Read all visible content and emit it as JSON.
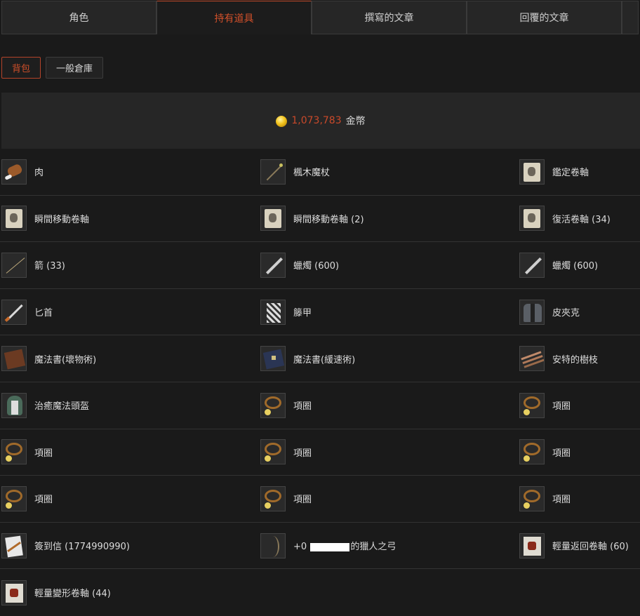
{
  "tabs": [
    "角色",
    "持有道具",
    "撰寫的文章",
    "回覆的文章"
  ],
  "subtabs": [
    "背包",
    "一般倉庫"
  ],
  "gold": {
    "amount": "1,073,783",
    "unit": "金幣"
  },
  "items": [
    [
      {
        "name": "肉",
        "icon": "meat-icon"
      },
      {
        "name": "楓木魔杖",
        "icon": "staff-icon"
      },
      {
        "name": "鑑定卷軸",
        "icon": "scroll-icon"
      }
    ],
    [
      {
        "name": "瞬間移動卷軸",
        "icon": "scroll-icon"
      },
      {
        "name": "瞬間移動卷軸 (2)",
        "icon": "scroll-icon"
      },
      {
        "name": "復活卷軸 (34)",
        "icon": "scroll-icon"
      }
    ],
    [
      {
        "name": "箭 (33)",
        "icon": "arrow-icon"
      },
      {
        "name": "蠟燭 (600)",
        "icon": "candle-icon"
      },
      {
        "name": "蠟燭 (600)",
        "icon": "candle-icon"
      }
    ],
    [
      {
        "name": "匕首",
        "icon": "dagger-icon"
      },
      {
        "name": "籐甲",
        "icon": "armor-icon"
      },
      {
        "name": "皮夾克",
        "icon": "jacket-icon"
      }
    ],
    [
      {
        "name": "魔法書(壞物術)",
        "icon": "book-icon"
      },
      {
        "name": "魔法書(緩速術)",
        "icon": "book-icon"
      },
      {
        "name": "安特的樹枝",
        "icon": "branch-icon"
      }
    ],
    [
      {
        "name": "治癒魔法頭盔",
        "icon": "helmet-icon"
      },
      {
        "name": "項圈",
        "icon": "necklace-icon"
      },
      {
        "name": "項圈",
        "icon": "necklace-icon"
      }
    ],
    [
      {
        "name": "項圈",
        "icon": "necklace-icon"
      },
      {
        "name": "項圈",
        "icon": "necklace-icon"
      },
      {
        "name": "項圈",
        "icon": "necklace-icon"
      }
    ],
    [
      {
        "name": "項圈",
        "icon": "necklace-icon"
      },
      {
        "name": "項圈",
        "icon": "necklace-icon"
      },
      {
        "name": "項圈",
        "icon": "necklace-icon"
      }
    ],
    [
      {
        "name": "簽到信 (1774990990)",
        "icon": "letter-icon"
      },
      {
        "prefix": "+0",
        "suffix": "的獵人之弓",
        "icon": "bow-icon"
      },
      {
        "name": "輕量返回卷軸 (60)",
        "icon": "scroll-icon"
      }
    ],
    [
      {
        "name": "輕量變形卷軸 (44)",
        "icon": "scroll-icon"
      }
    ]
  ]
}
